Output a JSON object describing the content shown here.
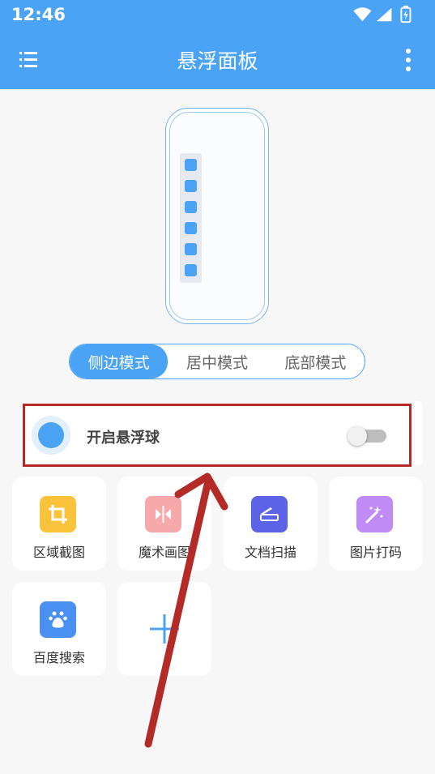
{
  "status": {
    "time": "12:46"
  },
  "header": {
    "title": "悬浮面板"
  },
  "modes": [
    {
      "label": "侧边模式",
      "active": true
    },
    {
      "label": "居中模式",
      "active": false
    },
    {
      "label": "底部模式",
      "active": false
    }
  ],
  "float_ball": {
    "label": "开启悬浮球",
    "enabled": false
  },
  "tools": [
    {
      "label": "区域截图",
      "icon": "crop-icon",
      "color": "#fbc23c"
    },
    {
      "label": "魔术画图",
      "icon": "magic-paint-icon",
      "color": "#f7a8a8"
    },
    {
      "label": "文档扫描",
      "icon": "scanner-icon",
      "color": "#5c63e6"
    },
    {
      "label": "图片打码",
      "icon": "magic-wand-icon",
      "color": "#c08bf5"
    },
    {
      "label": "百度搜索",
      "icon": "baidu-paw-icon",
      "color": "#4a8ff2"
    }
  ],
  "add_tool": {
    "icon": "plus-icon",
    "color": "#4aa3f5"
  },
  "colors": {
    "accent": "#4aa3f5",
    "annotation": "#b32a27"
  }
}
